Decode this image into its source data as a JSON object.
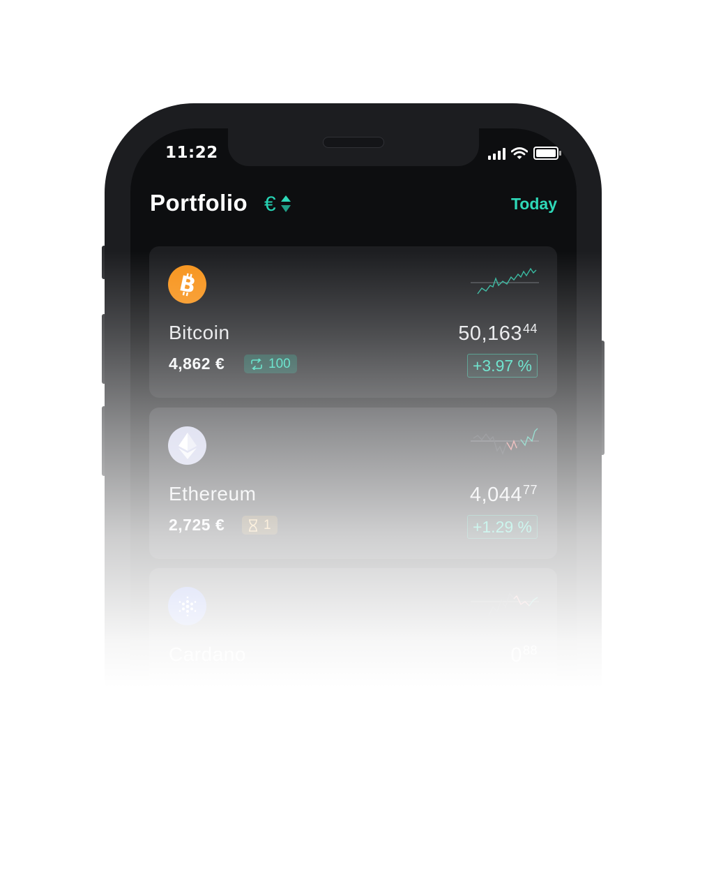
{
  "status_bar": {
    "time": "11:22"
  },
  "header": {
    "title": "Portfolio",
    "currency_symbol": "€",
    "period": "Today"
  },
  "colors": {
    "accent": "#2ed8b8",
    "bitcoin": "#f7931a",
    "ethereum": "#c6c9e6",
    "cardano": "#d6dcf5",
    "positive": "#33d9ba",
    "negative": "#f07a7a"
  },
  "assets": [
    {
      "name": "Bitcoin",
      "icon": "bitcoin-icon",
      "price_main": "50,163",
      "price_cents": "44",
      "value": "4,862 €",
      "badge_icon": "recurring-icon",
      "badge_text": "100",
      "change": "+3.97 %"
    },
    {
      "name": "Ethereum",
      "icon": "ethereum-icon",
      "price_main": "4,044",
      "price_cents": "77",
      "value": "2,725 €",
      "badge_icon": "hourglass-icon",
      "badge_text": "1",
      "change": "+1.29 %"
    },
    {
      "name": "Cardano",
      "icon": "cardano-icon",
      "price_main": "0",
      "price_cents": "88"
    }
  ]
}
